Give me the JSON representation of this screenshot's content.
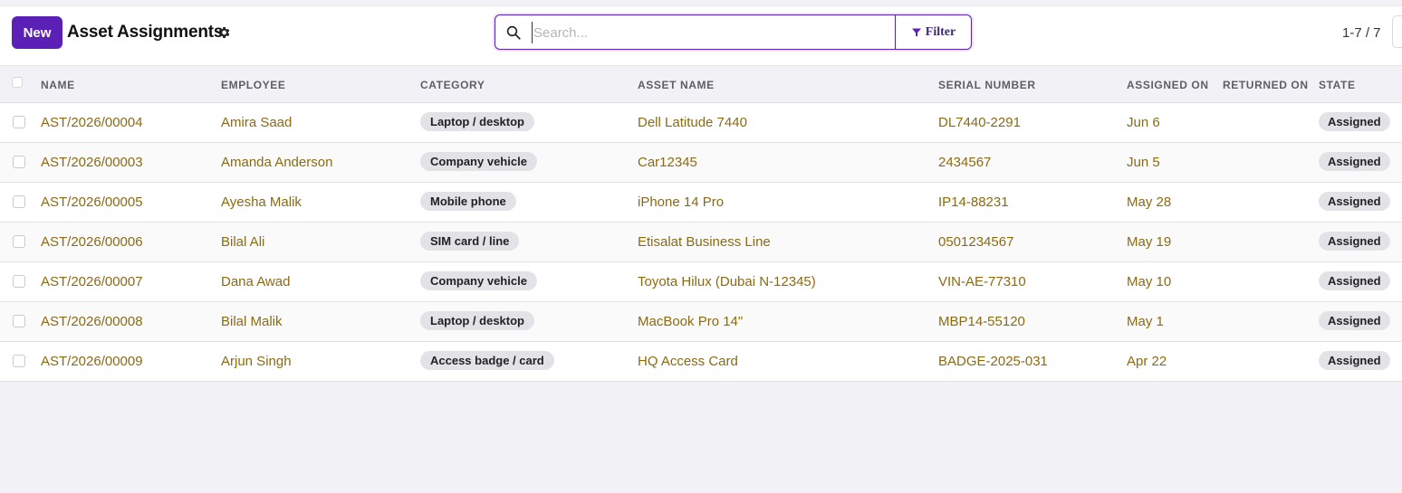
{
  "toolbar": {
    "new_label": "New",
    "title": "Asset Assignments",
    "search_placeholder": "Search...",
    "filter_label": "Filter",
    "pager": "1-7 / 7"
  },
  "columns": {
    "name": "NAME",
    "employee": "EMPLOYEE",
    "category": "CATEGORY",
    "asset": "ASSET NAME",
    "serial": "SERIAL NUMBER",
    "assigned_on": "ASSIGNED ON",
    "returned_on": "RETURNED ON",
    "state": "STATE"
  },
  "rows": [
    {
      "name": "AST/2026/00004",
      "employee": "Amira Saad",
      "category": "Laptop / desktop",
      "asset": "Dell Latitude 7440",
      "serial": "DL7440-2291",
      "assigned_on": "Jun 6",
      "returned_on": "",
      "state": "Assigned"
    },
    {
      "name": "AST/2026/00003",
      "employee": "Amanda Anderson",
      "category": "Company vehicle",
      "asset": "Car12345",
      "serial": "2434567",
      "assigned_on": "Jun 5",
      "returned_on": "",
      "state": "Assigned"
    },
    {
      "name": "AST/2026/00005",
      "employee": "Ayesha Malik",
      "category": "Mobile phone",
      "asset": "iPhone 14 Pro",
      "serial": "IP14-88231",
      "assigned_on": "May 28",
      "returned_on": "",
      "state": "Assigned"
    },
    {
      "name": "AST/2026/00006",
      "employee": "Bilal Ali",
      "category": "SIM card / line",
      "asset": "Etisalat Business Line",
      "serial": "0501234567",
      "assigned_on": "May 19",
      "returned_on": "",
      "state": "Assigned"
    },
    {
      "name": "AST/2026/00007",
      "employee": "Dana Awad",
      "category": "Company vehicle",
      "asset": "Toyota Hilux (Dubai N-12345)",
      "serial": "VIN-AE-77310",
      "assigned_on": "May 10",
      "returned_on": "",
      "state": "Assigned"
    },
    {
      "name": "AST/2026/00008",
      "employee": "Bilal Malik",
      "category": "Laptop / desktop",
      "asset": "MacBook Pro 14\"",
      "serial": "MBP14-55120",
      "assigned_on": "May 1",
      "returned_on": "",
      "state": "Assigned"
    },
    {
      "name": "AST/2026/00009",
      "employee": "Arjun Singh",
      "category": "Access badge / card",
      "asset": "HQ Access Card",
      "serial": "BADGE-2025-031",
      "assigned_on": "Apr 22",
      "returned_on": "",
      "state": "Assigned"
    }
  ],
  "colors": {
    "accent": "#5b21b6",
    "link_text": "#8a6b13",
    "tag_bg": "#e3e3e7"
  },
  "icons": [
    "gear-icon",
    "search-icon",
    "filter-icon"
  ]
}
